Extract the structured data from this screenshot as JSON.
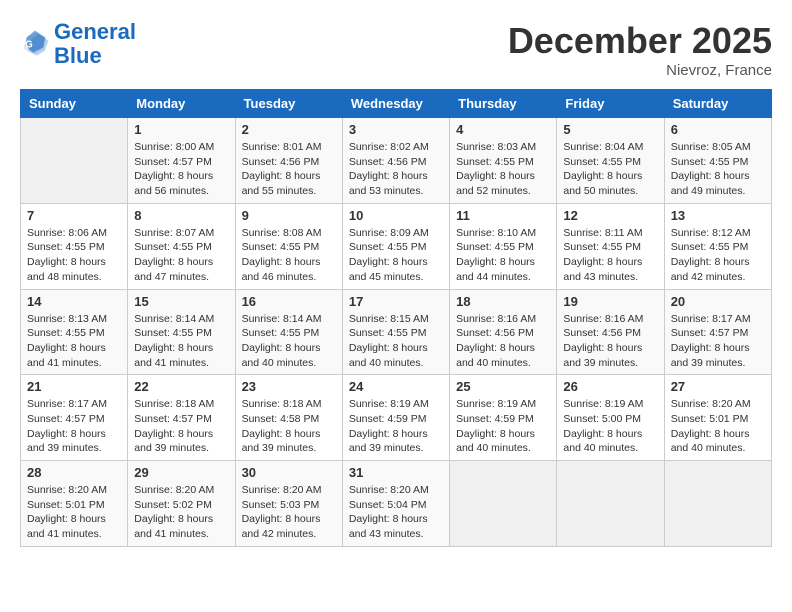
{
  "logo": {
    "line1": "General",
    "line2": "Blue"
  },
  "title": "December 2025",
  "location": "Nievroz, France",
  "weekdays": [
    "Sunday",
    "Monday",
    "Tuesday",
    "Wednesday",
    "Thursday",
    "Friday",
    "Saturday"
  ],
  "weeks": [
    [
      {
        "day": "",
        "sunrise": "",
        "sunset": "",
        "daylight": ""
      },
      {
        "day": "1",
        "sunrise": "Sunrise: 8:00 AM",
        "sunset": "Sunset: 4:57 PM",
        "daylight": "Daylight: 8 hours and 56 minutes."
      },
      {
        "day": "2",
        "sunrise": "Sunrise: 8:01 AM",
        "sunset": "Sunset: 4:56 PM",
        "daylight": "Daylight: 8 hours and 55 minutes."
      },
      {
        "day": "3",
        "sunrise": "Sunrise: 8:02 AM",
        "sunset": "Sunset: 4:56 PM",
        "daylight": "Daylight: 8 hours and 53 minutes."
      },
      {
        "day": "4",
        "sunrise": "Sunrise: 8:03 AM",
        "sunset": "Sunset: 4:55 PM",
        "daylight": "Daylight: 8 hours and 52 minutes."
      },
      {
        "day": "5",
        "sunrise": "Sunrise: 8:04 AM",
        "sunset": "Sunset: 4:55 PM",
        "daylight": "Daylight: 8 hours and 50 minutes."
      },
      {
        "day": "6",
        "sunrise": "Sunrise: 8:05 AM",
        "sunset": "Sunset: 4:55 PM",
        "daylight": "Daylight: 8 hours and 49 minutes."
      }
    ],
    [
      {
        "day": "7",
        "sunrise": "Sunrise: 8:06 AM",
        "sunset": "Sunset: 4:55 PM",
        "daylight": "Daylight: 8 hours and 48 minutes."
      },
      {
        "day": "8",
        "sunrise": "Sunrise: 8:07 AM",
        "sunset": "Sunset: 4:55 PM",
        "daylight": "Daylight: 8 hours and 47 minutes."
      },
      {
        "day": "9",
        "sunrise": "Sunrise: 8:08 AM",
        "sunset": "Sunset: 4:55 PM",
        "daylight": "Daylight: 8 hours and 46 minutes."
      },
      {
        "day": "10",
        "sunrise": "Sunrise: 8:09 AM",
        "sunset": "Sunset: 4:55 PM",
        "daylight": "Daylight: 8 hours and 45 minutes."
      },
      {
        "day": "11",
        "sunrise": "Sunrise: 8:10 AM",
        "sunset": "Sunset: 4:55 PM",
        "daylight": "Daylight: 8 hours and 44 minutes."
      },
      {
        "day": "12",
        "sunrise": "Sunrise: 8:11 AM",
        "sunset": "Sunset: 4:55 PM",
        "daylight": "Daylight: 8 hours and 43 minutes."
      },
      {
        "day": "13",
        "sunrise": "Sunrise: 8:12 AM",
        "sunset": "Sunset: 4:55 PM",
        "daylight": "Daylight: 8 hours and 42 minutes."
      }
    ],
    [
      {
        "day": "14",
        "sunrise": "Sunrise: 8:13 AM",
        "sunset": "Sunset: 4:55 PM",
        "daylight": "Daylight: 8 hours and 41 minutes."
      },
      {
        "day": "15",
        "sunrise": "Sunrise: 8:14 AM",
        "sunset": "Sunset: 4:55 PM",
        "daylight": "Daylight: 8 hours and 41 minutes."
      },
      {
        "day": "16",
        "sunrise": "Sunrise: 8:14 AM",
        "sunset": "Sunset: 4:55 PM",
        "daylight": "Daylight: 8 hours and 40 minutes."
      },
      {
        "day": "17",
        "sunrise": "Sunrise: 8:15 AM",
        "sunset": "Sunset: 4:55 PM",
        "daylight": "Daylight: 8 hours and 40 minutes."
      },
      {
        "day": "18",
        "sunrise": "Sunrise: 8:16 AM",
        "sunset": "Sunset: 4:56 PM",
        "daylight": "Daylight: 8 hours and 40 minutes."
      },
      {
        "day": "19",
        "sunrise": "Sunrise: 8:16 AM",
        "sunset": "Sunset: 4:56 PM",
        "daylight": "Daylight: 8 hours and 39 minutes."
      },
      {
        "day": "20",
        "sunrise": "Sunrise: 8:17 AM",
        "sunset": "Sunset: 4:57 PM",
        "daylight": "Daylight: 8 hours and 39 minutes."
      }
    ],
    [
      {
        "day": "21",
        "sunrise": "Sunrise: 8:17 AM",
        "sunset": "Sunset: 4:57 PM",
        "daylight": "Daylight: 8 hours and 39 minutes."
      },
      {
        "day": "22",
        "sunrise": "Sunrise: 8:18 AM",
        "sunset": "Sunset: 4:57 PM",
        "daylight": "Daylight: 8 hours and 39 minutes."
      },
      {
        "day": "23",
        "sunrise": "Sunrise: 8:18 AM",
        "sunset": "Sunset: 4:58 PM",
        "daylight": "Daylight: 8 hours and 39 minutes."
      },
      {
        "day": "24",
        "sunrise": "Sunrise: 8:19 AM",
        "sunset": "Sunset: 4:59 PM",
        "daylight": "Daylight: 8 hours and 39 minutes."
      },
      {
        "day": "25",
        "sunrise": "Sunrise: 8:19 AM",
        "sunset": "Sunset: 4:59 PM",
        "daylight": "Daylight: 8 hours and 40 minutes."
      },
      {
        "day": "26",
        "sunrise": "Sunrise: 8:19 AM",
        "sunset": "Sunset: 5:00 PM",
        "daylight": "Daylight: 8 hours and 40 minutes."
      },
      {
        "day": "27",
        "sunrise": "Sunrise: 8:20 AM",
        "sunset": "Sunset: 5:01 PM",
        "daylight": "Daylight: 8 hours and 40 minutes."
      }
    ],
    [
      {
        "day": "28",
        "sunrise": "Sunrise: 8:20 AM",
        "sunset": "Sunset: 5:01 PM",
        "daylight": "Daylight: 8 hours and 41 minutes."
      },
      {
        "day": "29",
        "sunrise": "Sunrise: 8:20 AM",
        "sunset": "Sunset: 5:02 PM",
        "daylight": "Daylight: 8 hours and 41 minutes."
      },
      {
        "day": "30",
        "sunrise": "Sunrise: 8:20 AM",
        "sunset": "Sunset: 5:03 PM",
        "daylight": "Daylight: 8 hours and 42 minutes."
      },
      {
        "day": "31",
        "sunrise": "Sunrise: 8:20 AM",
        "sunset": "Sunset: 5:04 PM",
        "daylight": "Daylight: 8 hours and 43 minutes."
      },
      {
        "day": "",
        "sunrise": "",
        "sunset": "",
        "daylight": ""
      },
      {
        "day": "",
        "sunrise": "",
        "sunset": "",
        "daylight": ""
      },
      {
        "day": "",
        "sunrise": "",
        "sunset": "",
        "daylight": ""
      }
    ]
  ]
}
